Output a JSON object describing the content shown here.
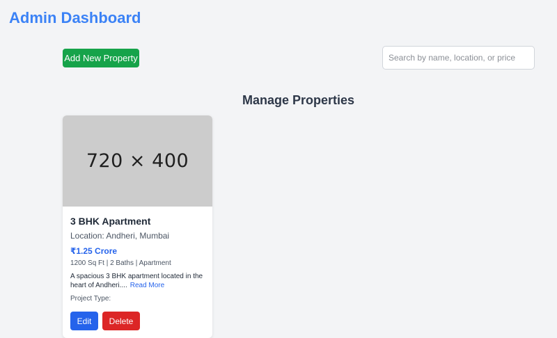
{
  "header": {
    "title": "Admin Dashboard"
  },
  "toolbar": {
    "add_label": "Add New Property",
    "search_placeholder": "Search by name, location, or price",
    "search_value": ""
  },
  "section": {
    "title": "Manage Properties"
  },
  "properties": [
    {
      "image_placeholder": "720 × 400",
      "title": "3 BHK Apartment",
      "location": "Location: Andheri, Mumbai",
      "price": "₹1.25 Crore",
      "meta": "1200 Sq Ft | 2 Baths | Apartment",
      "description": "A spacious 3 BHK apartment located in the heart of Andheri....",
      "read_more_label": "Read More",
      "project_type": "Project Type:",
      "edit_label": "Edit",
      "delete_label": "Delete"
    }
  ],
  "colors": {
    "title_accent": "#3b82f6",
    "add_button": "#16a34a",
    "edit_button": "#2563eb",
    "delete_button": "#dc2626",
    "price": "#2563eb"
  }
}
